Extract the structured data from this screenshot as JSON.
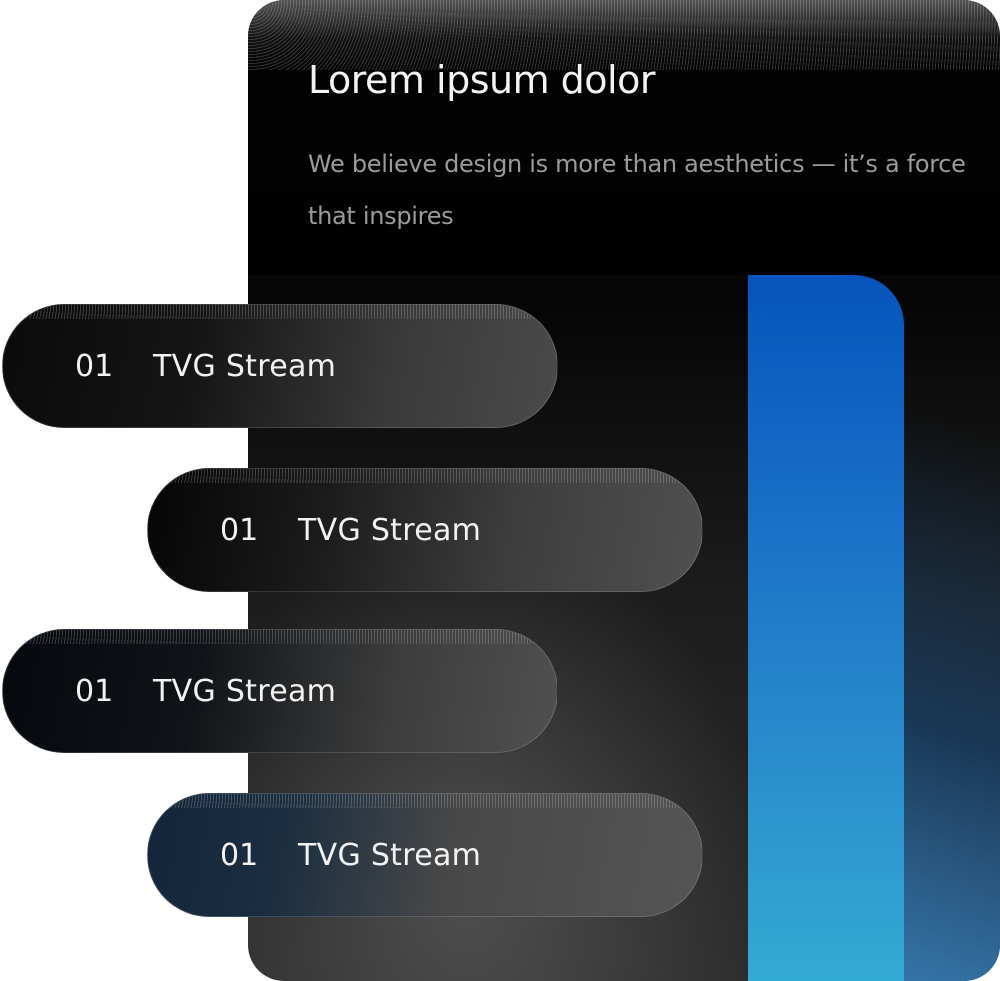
{
  "card": {
    "title": "Lorem ipsum dolor",
    "subtitle": "We believe design is more than aesthetics — it’s a force that inspires"
  },
  "items": [
    {
      "number": "01",
      "label": "TVG Stream"
    },
    {
      "number": "01",
      "label": "TVG Stream"
    },
    {
      "number": "01",
      "label": "TVG Stream"
    },
    {
      "number": "01",
      "label": "TVG Stream"
    }
  ],
  "colors": {
    "card_background": "#050505",
    "accent_blue_top": "#0654bb",
    "accent_blue_bottom": "#33aad4",
    "title_text": "#f4f4f4",
    "subtitle_text": "#9b9b9b"
  }
}
